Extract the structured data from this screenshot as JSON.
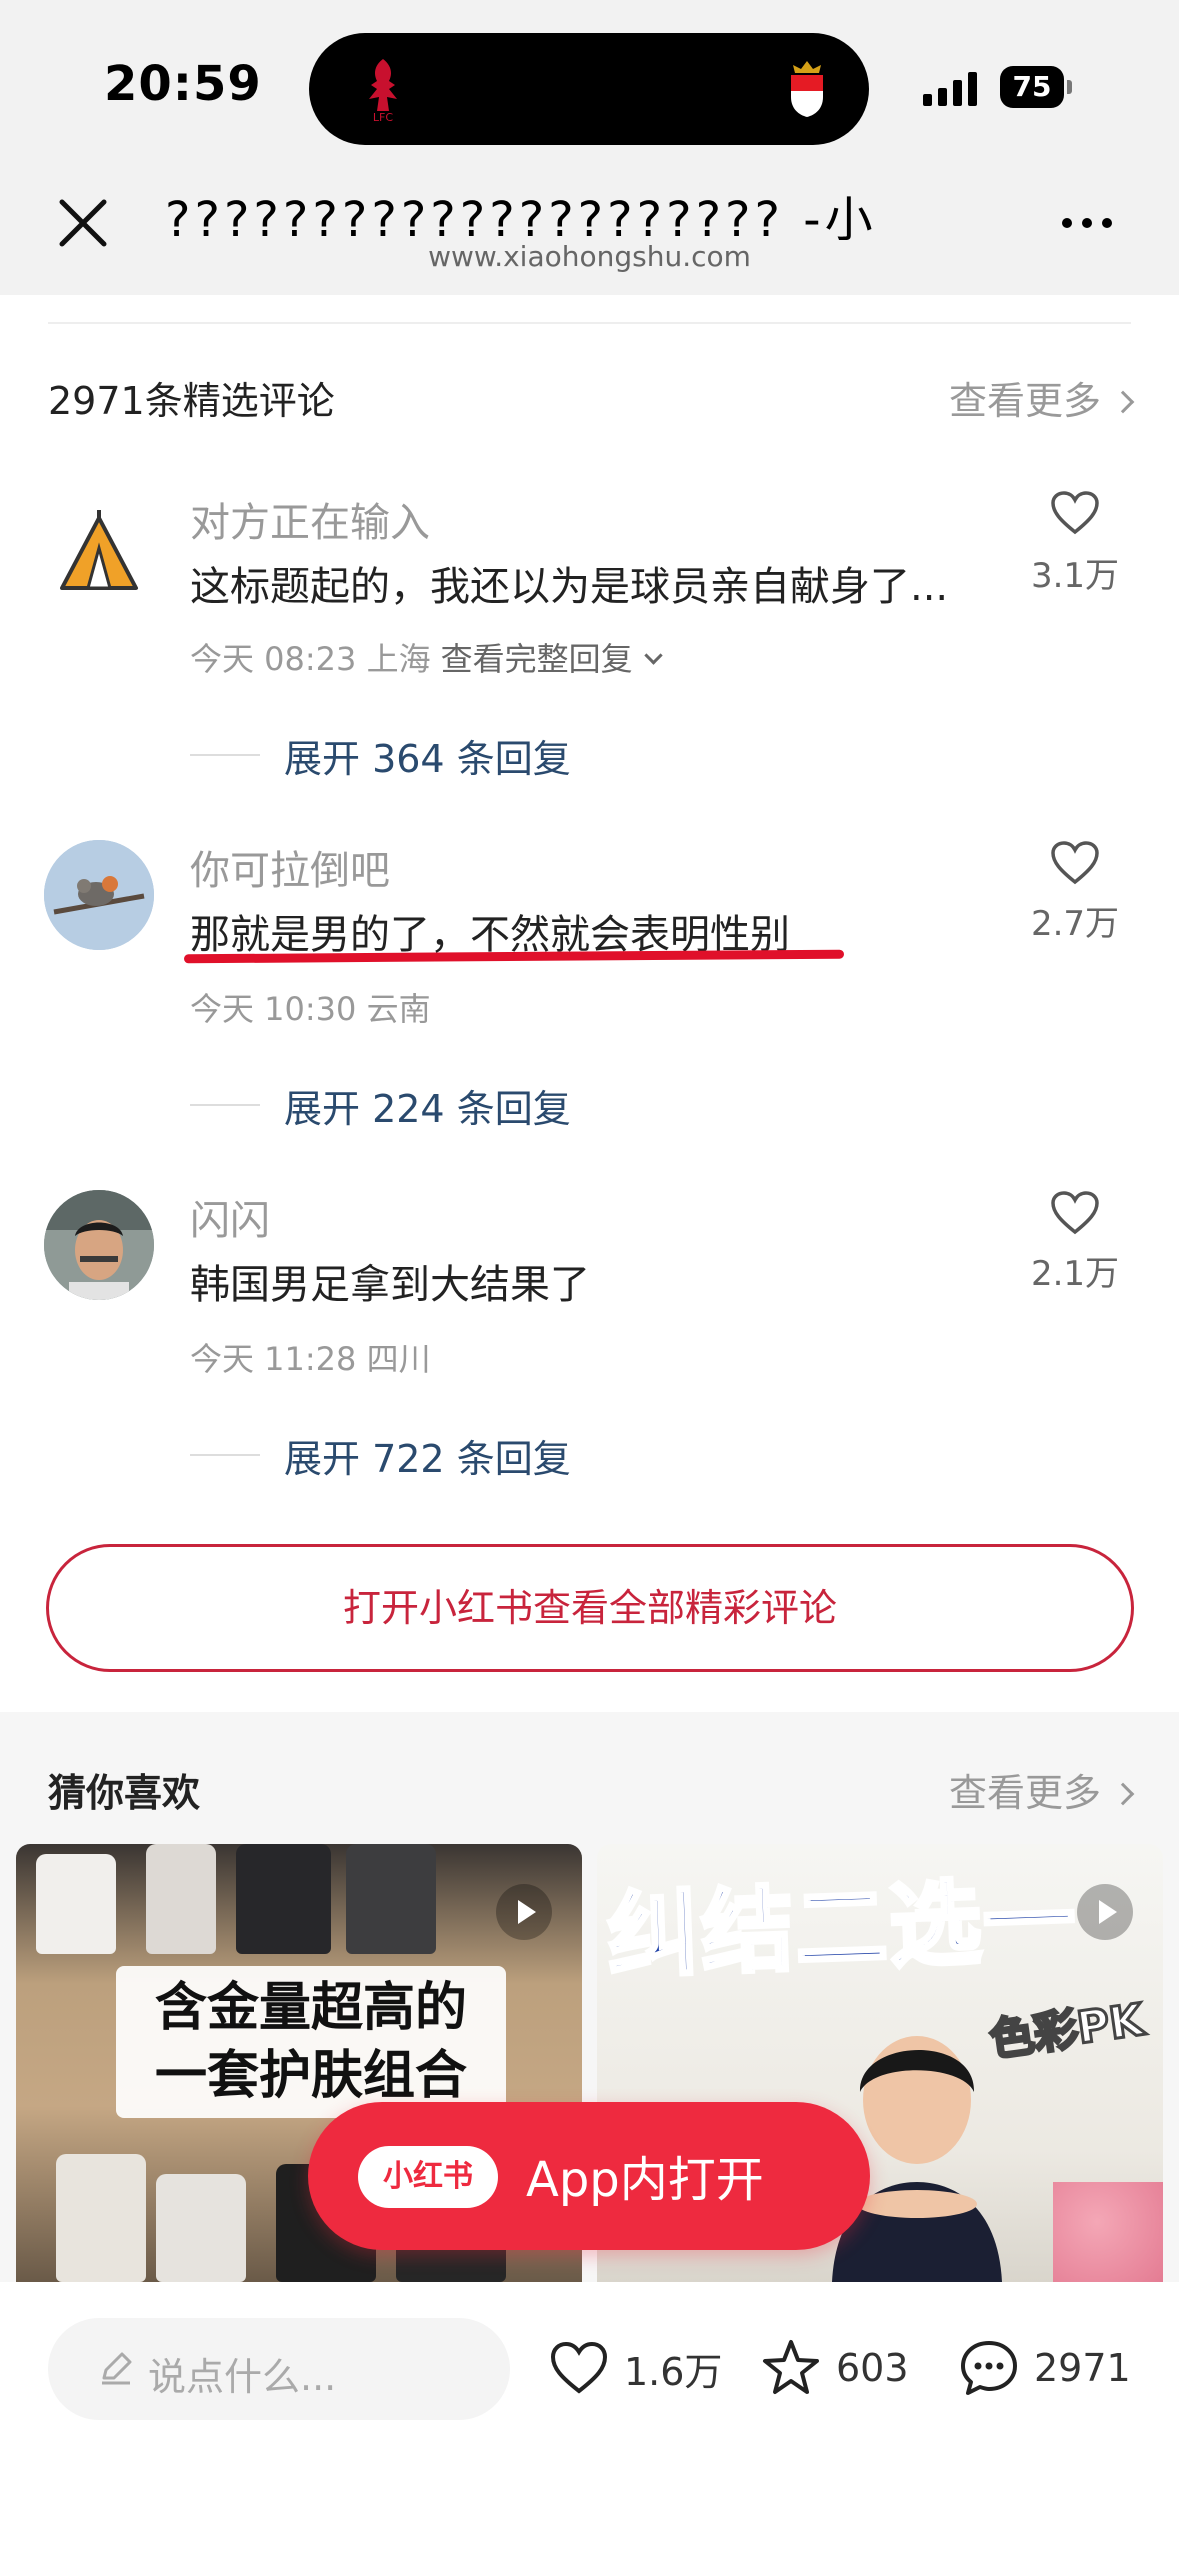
{
  "status_bar": {
    "time": "20:59",
    "battery": "75"
  },
  "browser": {
    "title": "????????????????????? -小",
    "url": "www.xiaohongshu.com"
  },
  "comments_section": {
    "title": "2971条精选评论",
    "see_more": "查看更多",
    "full_reply_label": "查看完整回复",
    "comments": [
      {
        "user": "对方正在输入",
        "text": "这标题起的，我还以为是球员亲自献身了...",
        "meta": "今天 08:23 上海",
        "likes": "3.1万",
        "expand": "展开 364 条回复"
      },
      {
        "user": "你可拉倒吧",
        "text": "那就是男的了，不然就会表明性别",
        "meta": "今天 10:30 云南",
        "likes": "2.7万",
        "expand": "展开 224 条回复"
      },
      {
        "user": "闪闪",
        "text": "韩国男足拿到大结果了",
        "meta": "今天 11:28 四川",
        "likes": "2.1万",
        "expand": "展开 722 条回复"
      }
    ],
    "open_all_button": "打开小红书查看全部精彩评论"
  },
  "recommendations": {
    "title": "猜你喜欢",
    "see_more": "查看更多",
    "cards": [
      {
        "caption_line1": "含金量超高的",
        "caption_line2": "一套护肤组合"
      },
      {
        "headline": "纠结二选一",
        "tag": "色彩PK"
      }
    ]
  },
  "app_open": {
    "logo": "小红书",
    "label": "App内打开"
  },
  "bottom_bar": {
    "placeholder": "说点什么...",
    "likes": "1.6万",
    "favorites": "603",
    "comments": "2971"
  },
  "colors": {
    "accent": "#ee2a3f",
    "link": "#2a4a6e",
    "highlight_line": "#e0102a"
  }
}
